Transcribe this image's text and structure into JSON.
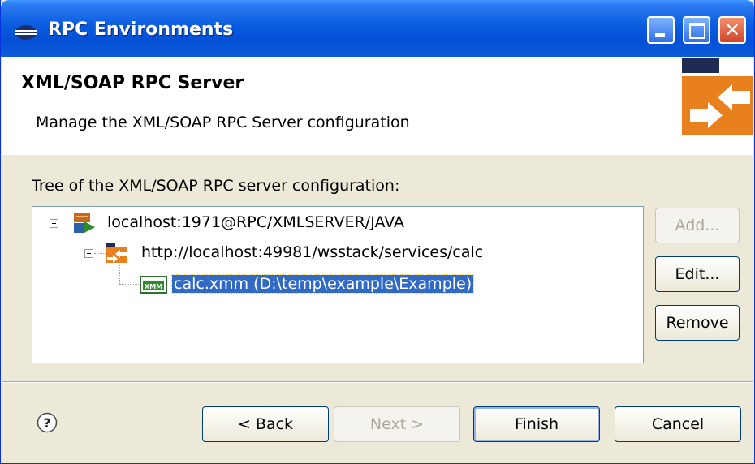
{
  "window": {
    "title": "RPC Environments",
    "title_icon": "eclipse-icon",
    "controls": {
      "minimize": "minimize-icon",
      "maximize": "maximize-icon",
      "close": "✕"
    }
  },
  "header": {
    "title": "XML/SOAP RPC Server",
    "description": "Manage the XML/SOAP RPC Server configuration",
    "banner_icon": "rpc-exchange-icon"
  },
  "tree": {
    "label": "Tree of the XML/SOAP RPC server configuration:",
    "nodes": [
      {
        "label": "localhost:1971@RPC/XMLSERVER/JAVA",
        "icon": "server-icon",
        "expanded": true
      },
      {
        "label": "http://localhost:49981/wsstack/services/calc",
        "icon": "rpc-service-icon",
        "expanded": true
      },
      {
        "label": "calc.xmm (D:\\temp\\example\\Example)",
        "icon": "xmm-file-icon",
        "selected": true
      }
    ]
  },
  "side_buttons": {
    "add": "Add...",
    "edit": "Edit...",
    "remove": "Remove"
  },
  "footer": {
    "help_icon": "help-icon",
    "back": "< Back",
    "next": "Next >",
    "finish": "Finish",
    "cancel": "Cancel"
  },
  "colors": {
    "titlebar": "#0a5ce0",
    "selection": "#316ac5",
    "dialog_bg": "#ece9d8",
    "banner_orange": "#e8801e"
  }
}
